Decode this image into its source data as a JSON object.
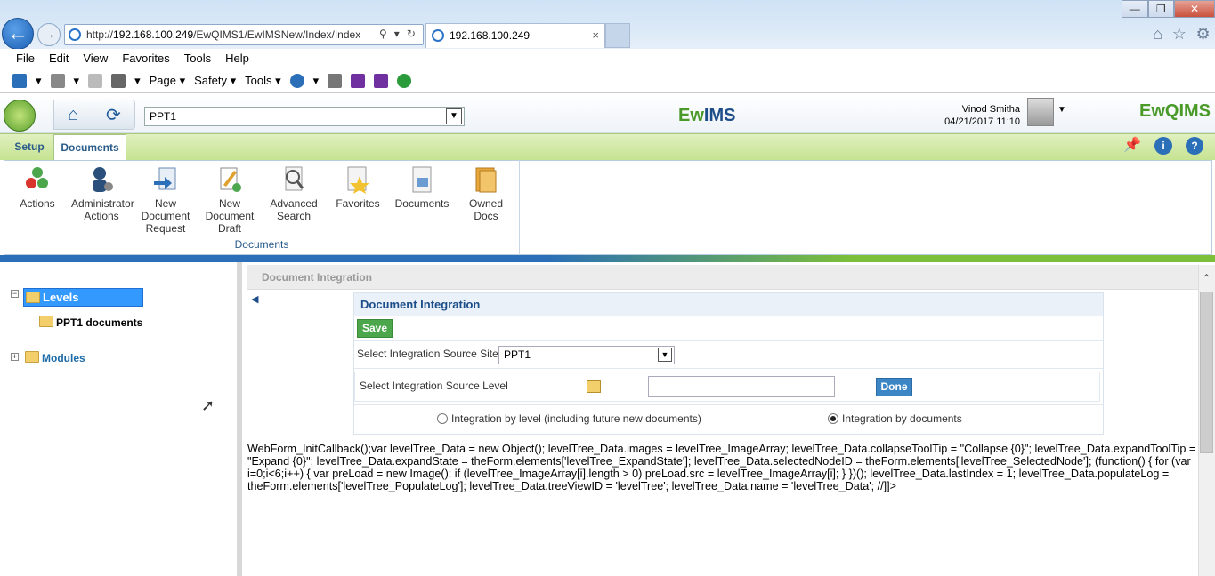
{
  "browser": {
    "address_prefix": "http://",
    "address_host": "192.168.100.249",
    "address_path": "/EwQIMS1/EwIMSNew/Index/Index",
    "tab_title": "192.168.100.249",
    "back_glyph": "←",
    "forward_glyph": "→",
    "tab_close_glyph": "×",
    "window_buttons": {
      "minimize": "—",
      "maximize": "❐",
      "close": "✕"
    },
    "right_icons": [
      "home-icon",
      "favorites-star-icon",
      "settings-gear-icon"
    ]
  },
  "menu": [
    "File",
    "Edit",
    "View",
    "Favorites",
    "Tools",
    "Help"
  ],
  "command_bar": {
    "page": "Page",
    "safety": "Safety",
    "tools": "Tools"
  },
  "app_header": {
    "site_select_value": "PPT1",
    "brand": {
      "prefix": "Ew",
      "suffix": "IMS"
    },
    "user_name": "Vinod Smitha",
    "datetime": "04/21/2017 11:10",
    "brand_right": "EwQIMS"
  },
  "ribbon": {
    "tabs": {
      "setup": "Setup",
      "documents": "Documents"
    },
    "group_label": "Documents",
    "buttons": {
      "actions": "Actions",
      "admin": "Administrator Actions",
      "new_request": "New Document Request",
      "new_draft": "New Document Draft",
      "advanced_search": "Advanced Search",
      "favorites": "Favorites",
      "documents": "Documents",
      "owned_docs": "Owned Docs"
    }
  },
  "tree": {
    "levels": "Levels",
    "ppt1_documents": "PPT1 documents",
    "modules": "Modules",
    "expanded_glyph": "−",
    "collapsed_glyph": "+"
  },
  "content": {
    "breadcrumb": "Document Integration",
    "panel_title": "Document Integration",
    "save": "Save",
    "select_site_label": "Select Integration Source Site",
    "select_site_value": "PPT1",
    "select_level_label": "Select Integration Source Level",
    "level_input_value": "",
    "done": "Done",
    "radio_by_level": "Integration by level (including future new documents)",
    "radio_by_documents": "Integration by documents",
    "radio_selected": "documents",
    "script_text": "WebForm_InitCallback();var levelTree_Data = new Object(); levelTree_Data.images = levelTree_ImageArray; levelTree_Data.collapseToolTip = \"Collapse {0}\"; levelTree_Data.expandToolTip = \"Expand {0}\"; levelTree_Data.expandState = theForm.elements['levelTree_ExpandState']; levelTree_Data.selectedNodeID = theForm.elements['levelTree_SelectedNode']; (function() { for (var i=0;i<6;i++) { var preLoad = new Image(); if (levelTree_ImageArray[i].length > 0) preLoad.src = levelTree_ImageArray[i]; } })(); levelTree_Data.lastIndex = 1; levelTree_Data.populateLog = theForm.elements['levelTree_PopulateLog']; levelTree_Data.treeViewID = 'levelTree'; levelTree_Data.name = 'levelTree_Data'; //]]>"
  },
  "colors": {
    "ribbon_green": "#c6e391",
    "tree_selected": "#3399ff",
    "save_green": "#4ca64c",
    "done_blue": "#3d86c6",
    "brand_blue": "#1d4e8a"
  }
}
